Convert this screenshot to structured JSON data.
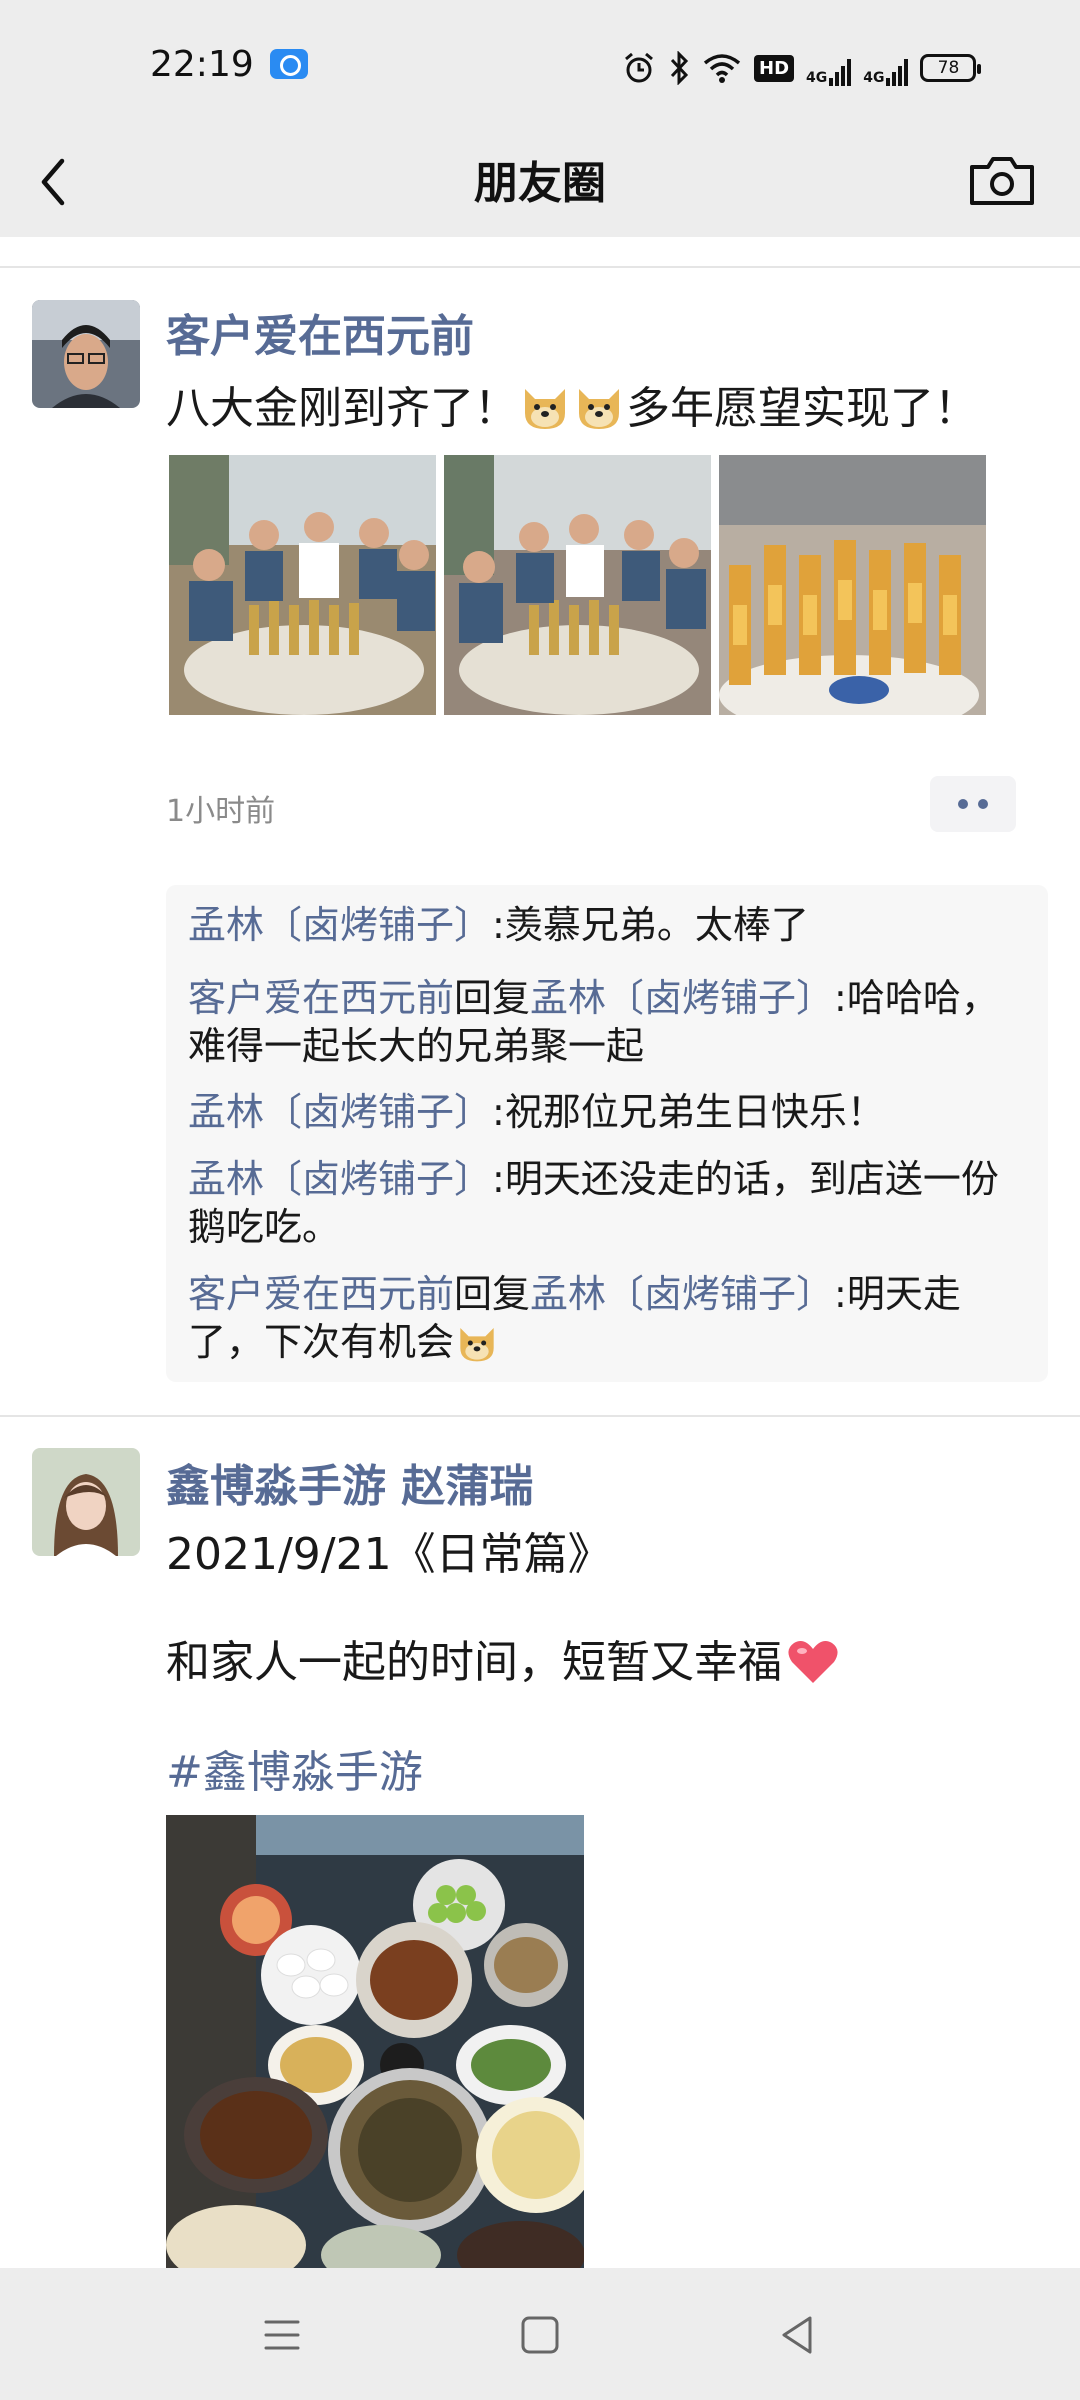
{
  "status_bar": {
    "time": "22:19",
    "app_icon": "browser-app-icon",
    "hd_label": "HD",
    "signal1_label": "4G",
    "signal2_label": "4G",
    "battery": "78"
  },
  "nav": {
    "title": "朋友圈",
    "back_icon": "chevron-left-icon",
    "camera_icon": "camera-icon"
  },
  "posts": [
    {
      "author": "客户爱在西元前",
      "text_before": "八大金刚到齐了！",
      "text_after": "多年愿望实现了！",
      "emoji": "doge-emoji",
      "photo_count": 3,
      "time": "1小时前",
      "comments": [
        {
          "name": "孟林〔卤烤铺子〕",
          "sep": ":",
          "text": "羡慕兄弟。太棒了"
        },
        {
          "name": "客户爱在西元前",
          "reply_word": "回复",
          "reply_to": "孟林〔卤烤铺子〕",
          "sep": ":",
          "text": "哈哈哈，难得一起长大的兄弟聚一起"
        },
        {
          "name": "孟林〔卤烤铺子〕",
          "sep": ":",
          "text": "祝那位兄弟生日快乐！"
        },
        {
          "name": "孟林〔卤烤铺子〕",
          "sep": ":",
          "text": "明天还没走的话，到店送一份鹅吃吃。"
        },
        {
          "name": "客户爱在西元前",
          "reply_word": "回复",
          "reply_to": "孟林〔卤烤铺子〕",
          "sep": ":",
          "text": "明天走了，下次有机会"
        }
      ]
    },
    {
      "author": "鑫博淼手游  赵蒲瑞",
      "line1": "2021/9/21《日常篇》",
      "line2": "和家人一起的时间，短暂又幸福",
      "hashtag": "#鑫博淼手游",
      "photo_count": 1
    }
  ],
  "system_nav": {
    "menu_icon": "menu-icon",
    "home_icon": "home-square-icon",
    "back_icon": "back-triangle-icon"
  },
  "colors": {
    "link_blue": "#576b95",
    "header_bg": "#ededed"
  }
}
